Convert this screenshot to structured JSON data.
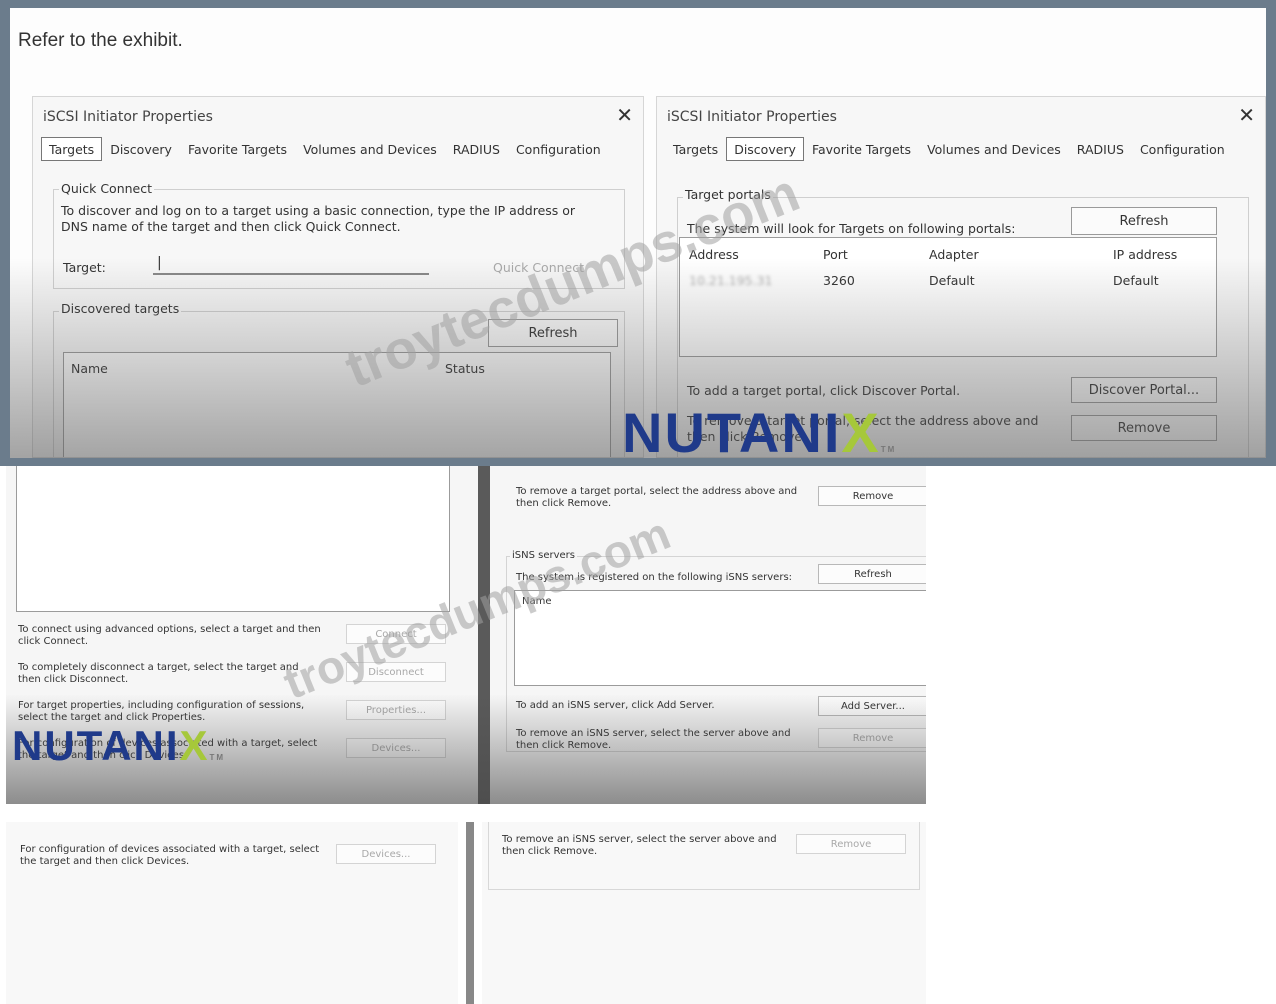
{
  "caption": "Refer to the exhibit.",
  "left_dialog": {
    "title": "iSCSI Initiator Properties",
    "close": "✕",
    "tabs": [
      "Targets",
      "Discovery",
      "Favorite Targets",
      "Volumes and Devices",
      "RADIUS",
      "Configuration"
    ],
    "active_tab": "Targets",
    "quick_connect": {
      "group_label": "Quick Connect",
      "description_line1": "To discover and log on to a target using a basic connection, type the IP address or",
      "description_line2": "DNS name of the target and then click Quick Connect.",
      "target_label": "Target:",
      "target_value": "|",
      "quick_connect_button": "Quick Connect"
    },
    "discovered_targets": {
      "group_label": "Discovered targets",
      "refresh_button": "Refresh",
      "col_name": "Name",
      "col_status": "Status"
    }
  },
  "right_dialog": {
    "title": "iSCSI Initiator Properties",
    "close": "✕",
    "tabs": [
      "Targets",
      "Discovery",
      "Favorite Targets",
      "Volumes and Devices",
      "RADIUS",
      "Configuration"
    ],
    "active_tab": "Discovery",
    "target_portals": {
      "group_label": "Target portals",
      "description": "The system will look for Targets on following portals:",
      "refresh_button": "Refresh",
      "columns": [
        "Address",
        "Port",
        "Adapter",
        "IP address"
      ],
      "rows": [
        {
          "address": "10.21.195.31",
          "port": "3260",
          "adapter": "Default",
          "ip_address": "Default"
        }
      ],
      "add_text": "To add a target portal, click Discover Portal.",
      "discover_button": "Discover Portal...",
      "remove_text_line1": "To remove a target portal, select the address above and",
      "remove_text_line2": "then click Remove.",
      "remove_button": "Remove"
    }
  },
  "lower_left": {
    "connect_text_line1": "To connect using advanced options, select a target and then",
    "connect_text_line2": "click Connect.",
    "connect_button": "Connect",
    "disconnect_text_line1": "To completely disconnect a target, select the target and",
    "disconnect_text_line2": "then click Disconnect.",
    "disconnect_button": "Disconnect",
    "properties_text_line1": "For target properties, including configuration of sessions,",
    "properties_text_line2": "select the target and click Properties.",
    "properties_button": "Properties...",
    "devices_text_line1": "For configuration of devices associated with a target, select",
    "devices_text_line2": "the target and then click Devices.",
    "devices_button": "Devices..."
  },
  "lower_right": {
    "remove_portal_text_line1": "To remove a target portal, select the address above and",
    "remove_portal_text_line2": "then click Remove.",
    "remove_portal_button": "Remove",
    "isns_group_label": "iSNS servers",
    "isns_description": "The system is registered on the following iSNS servers:",
    "isns_refresh_button": "Refresh",
    "isns_col_name": "Name",
    "add_server_text": "To add an iSNS server, click Add Server.",
    "add_server_button": "Add Server...",
    "remove_server_text_line1": "To remove an iSNS server, select the server above and",
    "remove_server_text_line2": "then click Remove.",
    "remove_server_button": "Remove"
  },
  "bottom_left": {
    "devices_text_line1": "For configuration of devices associated with a target, select",
    "devices_text_line2": "the target and then click Devices.",
    "devices_button": "Devices..."
  },
  "bottom_right": {
    "remove_server_text_line1": "To remove an iSNS server, select the server above and",
    "remove_server_text_line2": "then click Remove.",
    "remove_server_button": "Remove"
  },
  "watermarks": {
    "site_top": "troytecdumps.com",
    "site_bottom": "troytecdumps.com",
    "logo_text": "NUTANI",
    "logo_x": "X",
    "logo_tm": "TM"
  },
  "colors": {
    "frame": "#6b7c8c",
    "nutanix_blue": "#1f3a8a",
    "nutanix_green": "#a6c83a"
  }
}
